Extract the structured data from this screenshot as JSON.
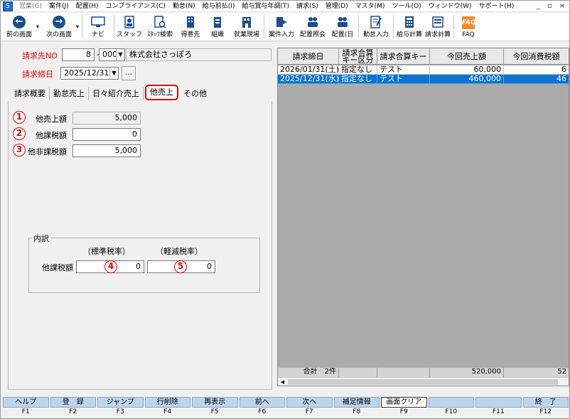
{
  "menu": [
    "営業(G)",
    "案件(J)",
    "配置(H)",
    "コンプライアンス(C)",
    "勤怠(N)",
    "給与前払(I)",
    "給与賞与年調(T)",
    "請求(S)",
    "管理(D)",
    "マスタ(M)",
    "ツール(O)",
    "ウィンドウ(W)",
    "サポート(H)"
  ],
  "window_controls": [
    "_",
    "▫",
    "×"
  ],
  "toolbar": {
    "back": "前の画面",
    "forward": "次の画面",
    "buttons": [
      "ナビ",
      "スタッフ",
      "ｽﾀｯﾌ検索",
      "得意先",
      "組織",
      "就業現場",
      "案件入力",
      "配置照会",
      "配置(日",
      "勤怠入力",
      "給与計算",
      "請求計算",
      "FAQ"
    ]
  },
  "form": {
    "invoice_no_label": "請求先NO",
    "invoice_no": "8",
    "invoice_sep": "-",
    "invoice_branch": "000",
    "company_name": "株式会社さっぽろ",
    "close_date_label": "請求締日",
    "close_date": "2025/12/31",
    "ellipsis": "..."
  },
  "tabs": [
    "請求概要",
    "勤怠売上",
    "日々紹介売上",
    "他売上",
    "その他"
  ],
  "other_sales": {
    "sales_label": "他売上額",
    "sales_value": "5,000",
    "taxable_label": "他課税額",
    "taxable_value": "0",
    "nontaxable_label": "他非課税額",
    "nontaxable_value": "5,000",
    "markers": [
      "1",
      "2",
      "3",
      "4",
      "5"
    ],
    "breakdown_title": "内訳",
    "std_rate_label": "（標準税率）",
    "reduced_rate_label": "（軽減税率）",
    "breakdown_taxable_label": "他課税額",
    "std_value": "0",
    "reduced_value": "0"
  },
  "grid": {
    "headers": [
      "請求締日",
      "請求合算\nキー区分",
      "請求合算キー",
      "今回売上額",
      "今回消費税額"
    ],
    "rows": [
      [
        "2026/01/31(土)",
        "指定なし",
        "テスト",
        "60,000",
        "6"
      ],
      [
        "2025/12/31(水)",
        "指定なし",
        "テスト",
        "460,000",
        "46"
      ]
    ],
    "footer": [
      "合計　2件",
      "",
      "",
      "520,000",
      "52"
    ]
  },
  "fkeys": [
    {
      "label": "ヘルプ",
      "key": "F1"
    },
    {
      "label": "登　録",
      "key": "F2"
    },
    {
      "label": "ジャンプ",
      "key": "F3"
    },
    {
      "label": "行削除",
      "key": "F4"
    },
    {
      "label": "再表示",
      "key": "F5"
    },
    {
      "label": "前へ",
      "key": "F6"
    },
    {
      "label": "次へ",
      "key": "F7"
    },
    {
      "label": "補足情報",
      "key": "F8"
    },
    {
      "label": "画面クリア",
      "key": "F9"
    },
    {
      "label": "",
      "key": "F10"
    },
    {
      "label": "",
      "key": "F11"
    },
    {
      "label": "終　了",
      "key": "F12"
    }
  ],
  "colors": {
    "accent_red": "#e60000",
    "selection_blue": "#0a74d0",
    "fkey_blue": "#bcd4ec"
  }
}
